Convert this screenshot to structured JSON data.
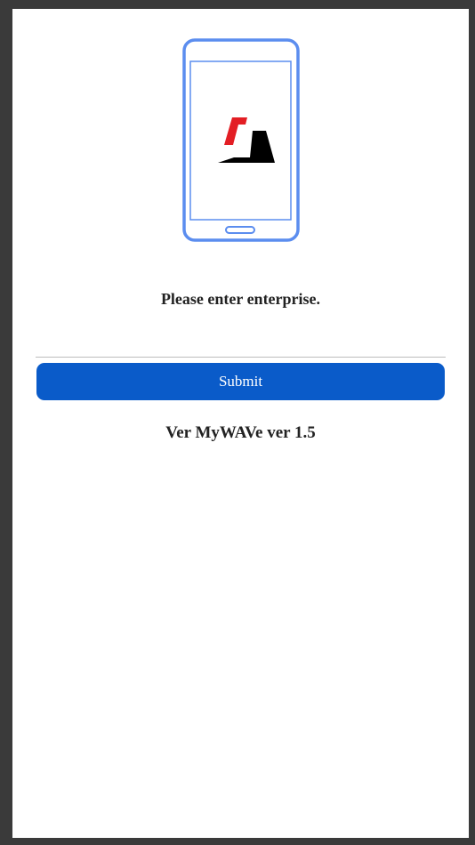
{
  "login": {
    "prompt": "Please enter enterprise.",
    "enterprise_value": "",
    "enterprise_placeholder": "",
    "submit_label": "Submit",
    "version": "Ver MyWAVe ver 1.5"
  },
  "illustration": {
    "device_icon": "smartphone-icon",
    "logo_icon": "brand-logo-icon",
    "frame_color": "#5b8def",
    "logo_colors": [
      "#e31e24",
      "#000000"
    ]
  },
  "theme": {
    "primary_button": "#0a5bc9",
    "background": "#ffffff",
    "outer_frame": "#3a3a3a"
  }
}
